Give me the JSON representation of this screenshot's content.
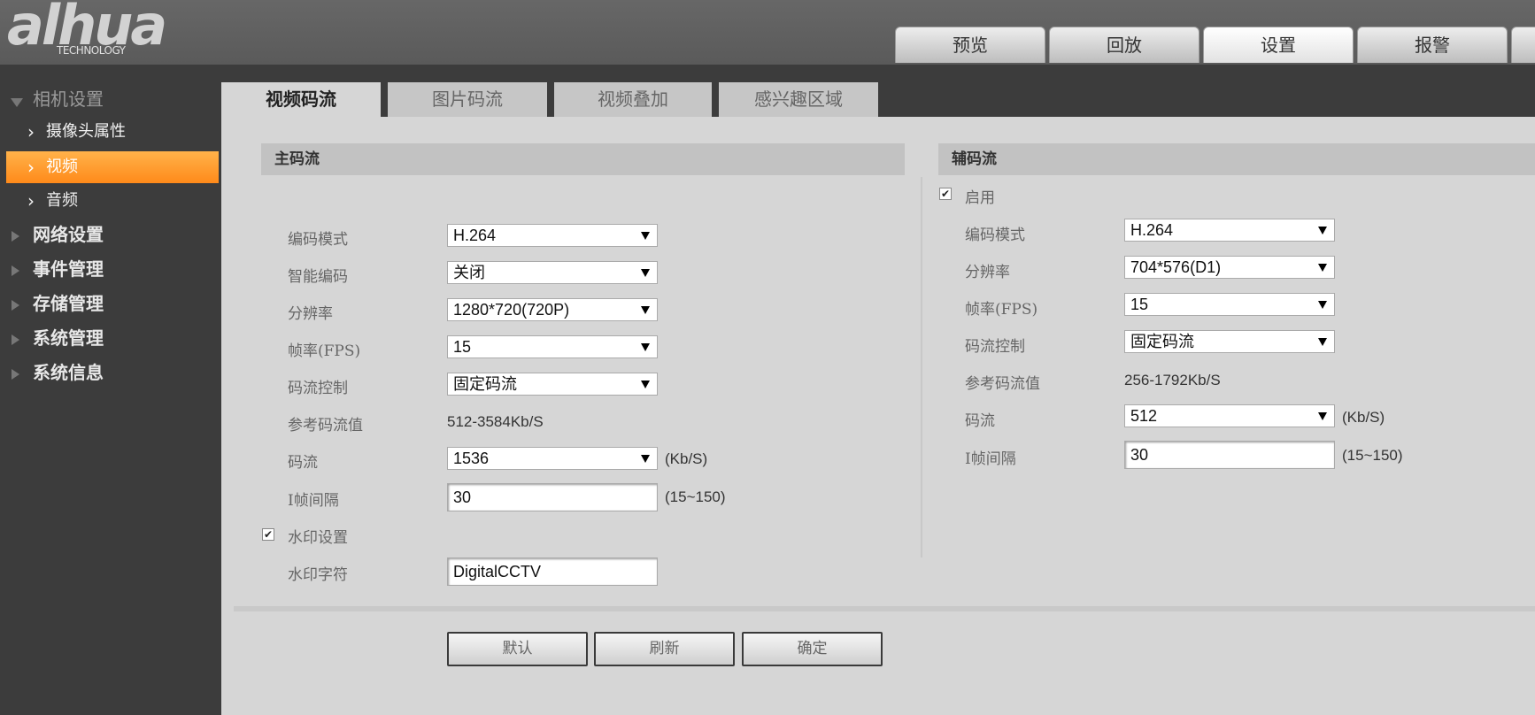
{
  "brand": {
    "logo_text": "alhua",
    "logo_sub": "TECHNOLOGY"
  },
  "main_tabs": [
    {
      "label": "预览"
    },
    {
      "label": "回放"
    },
    {
      "label": "设置",
      "active": true
    },
    {
      "label": "报警"
    }
  ],
  "sidebar": {
    "camera_settings": "相机设置",
    "camera_properties": "摄像头属性",
    "video": "视频",
    "audio": "音频",
    "network": "网络设置",
    "event": "事件管理",
    "storage": "存储管理",
    "system": "系统管理",
    "system_info": "系统信息"
  },
  "content_tabs": [
    {
      "label": "视频码流",
      "active": true
    },
    {
      "label": "图片码流"
    },
    {
      "label": "视频叠加"
    },
    {
      "label": "感兴趣区域"
    }
  ],
  "main_stream": {
    "title": "主码流",
    "encode_mode_label": "编码模式",
    "encode_mode": "H.264",
    "smart_codec_label": "智能编码",
    "smart_codec": "关闭",
    "resolution_label": "分辨率",
    "resolution": "1280*720(720P)",
    "fps_label": "帧率(FPS)",
    "fps": "15",
    "bitrate_control_label": "码流控制",
    "bitrate_control": "固定码流",
    "ref_bitrate_label": "参考码流值",
    "ref_bitrate": "512-3584Kb/S",
    "bitrate_label": "码流",
    "bitrate": "1536",
    "bitrate_unit": "(Kb/S)",
    "iframe_label": "I帧间隔",
    "iframe": "30",
    "iframe_range": "(15~150)",
    "watermark_label": "水印设置",
    "watermark_checked": true,
    "watermark_text_label": "水印字符",
    "watermark_text": "DigitalCCTV"
  },
  "sub_stream": {
    "title": "辅码流",
    "enable_label": "启用",
    "enabled": true,
    "encode_mode_label": "编码模式",
    "encode_mode": "H.264",
    "resolution_label": "分辨率",
    "resolution": "704*576(D1)",
    "fps_label": "帧率(FPS)",
    "fps": "15",
    "bitrate_control_label": "码流控制",
    "bitrate_control": "固定码流",
    "ref_bitrate_label": "参考码流值",
    "ref_bitrate": "256-1792Kb/S",
    "bitrate_label": "码流",
    "bitrate": "512",
    "bitrate_unit": "(Kb/S)",
    "iframe_label": "I帧间隔",
    "iframe": "30",
    "iframe_range": "(15~150)"
  },
  "buttons": {
    "default": "默认",
    "refresh": "刷新",
    "ok": "确定"
  },
  "colors": {
    "accent": "#ff9a2a",
    "sidebar_bg": "#3c3c3c",
    "topbar_bg": "#606060"
  },
  "icons": {
    "checkbox": "✔",
    "expand": "triangle-right-icon",
    "collapse": "triangle-down-icon",
    "chevron": "chevron-right-icon"
  }
}
